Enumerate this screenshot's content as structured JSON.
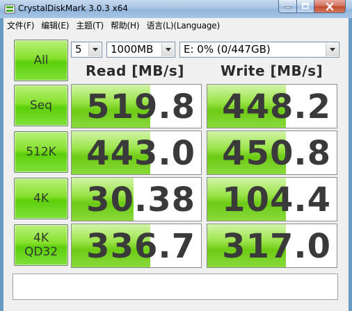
{
  "window": {
    "title": "CrystalDiskMark 3.0.3 x64",
    "frame_color": "#6a9bc3"
  },
  "menu": [
    {
      "label": "文件(F)"
    },
    {
      "label": "编辑(E)"
    },
    {
      "label": "主题(T)"
    },
    {
      "label": "帮助(H)"
    },
    {
      "label": "语言(L)(Language)"
    }
  ],
  "controls": {
    "all_button": "All",
    "count": "5",
    "size": "1000MB",
    "drive": "E: 0% (0/447GB)"
  },
  "headers": {
    "read": "Read [MB/s]",
    "write": "Write [MB/s]"
  },
  "rows": [
    {
      "label": "Seq",
      "read": "519.8",
      "write": "448.2",
      "read_fill": 0.61,
      "write_fill": 0.61
    },
    {
      "label": "512K",
      "read": "443.0",
      "write": "450.8",
      "read_fill": 0.61,
      "write_fill": 0.61
    },
    {
      "label": "4K",
      "read": "30.38",
      "write": "104.4",
      "read_fill": 0.48,
      "write_fill": 0.61
    },
    {
      "label": "4K\nQD32",
      "read": "336.7",
      "write": "317.0",
      "read_fill": 0.61,
      "write_fill": 0.61
    }
  ],
  "status": {
    "text": ""
  },
  "colors": {
    "button_green": "#5ccf0a",
    "bar_green": "#6ccb14",
    "close_red": "#c04a30"
  }
}
